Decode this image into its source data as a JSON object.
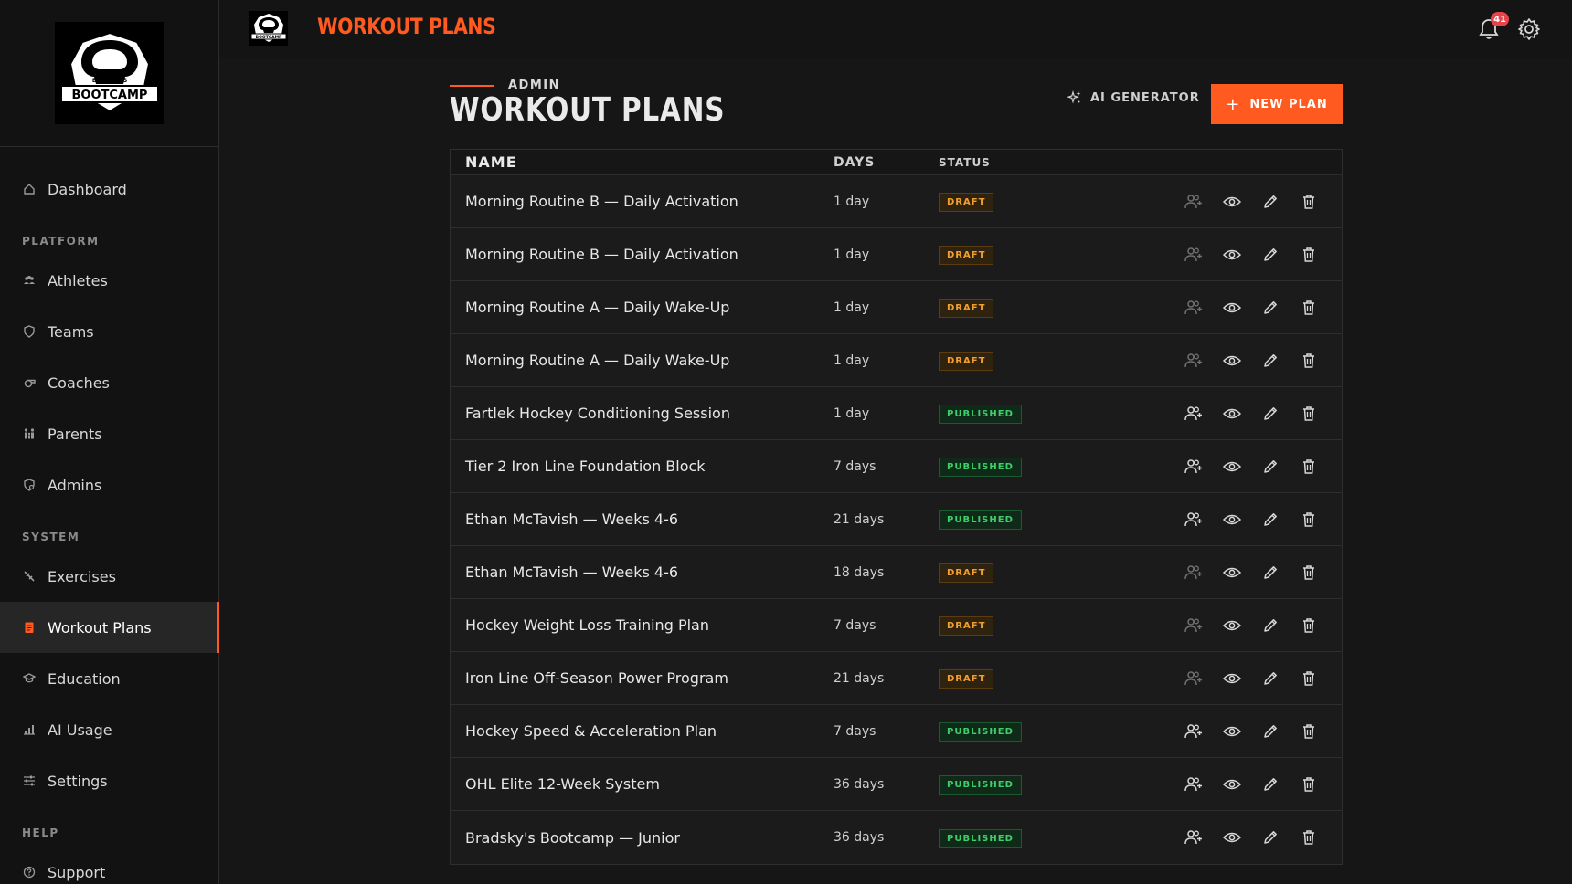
{
  "brand": {
    "logo_top": "BRADSKY'S",
    "logo_main": "BOOTCAMP",
    "mini_logo": "BOOTCAMP",
    "accent": "#ff5a1f"
  },
  "topbar": {
    "title": "WORKOUT PLANS",
    "notification_count": "41"
  },
  "sidebar": {
    "dashboard": "Dashboard",
    "sections": {
      "platform": "PLATFORM",
      "system": "SYSTEM",
      "help": "HELP"
    },
    "platform_items": [
      {
        "label": "Athletes",
        "icon": "athletes-icon"
      },
      {
        "label": "Teams",
        "icon": "shield-icon"
      },
      {
        "label": "Coaches",
        "icon": "whistle-icon"
      },
      {
        "label": "Parents",
        "icon": "family-icon"
      },
      {
        "label": "Admins",
        "icon": "admin-icon"
      }
    ],
    "system_items": [
      {
        "label": "Exercises",
        "icon": "dumbbell-icon"
      },
      {
        "label": "Workout Plans",
        "icon": "clipboard-icon",
        "active": true
      },
      {
        "label": "Education",
        "icon": "graduation-icon"
      },
      {
        "label": "AI Usage",
        "icon": "chart-icon"
      },
      {
        "label": "Settings",
        "icon": "sliders-icon"
      }
    ],
    "help_items": [
      {
        "label": "Support",
        "icon": "help-circle-icon"
      }
    ]
  },
  "header": {
    "eyebrow": "ADMIN",
    "title": "WORKOUT PLANS",
    "ai_generator": "AI GENERATOR",
    "new_plan": "NEW PLAN"
  },
  "table": {
    "columns": {
      "name": "NAME",
      "days": "DAYS",
      "status": "STATUS"
    },
    "rows": [
      {
        "name": "Morning Routine B — Daily Activation",
        "days": "1 day",
        "status": "DRAFT"
      },
      {
        "name": "Morning Routine B — Daily Activation",
        "days": "1 day",
        "status": "DRAFT"
      },
      {
        "name": "Morning Routine A — Daily Wake-Up",
        "days": "1 day",
        "status": "DRAFT"
      },
      {
        "name": "Morning Routine A — Daily Wake-Up",
        "days": "1 day",
        "status": "DRAFT"
      },
      {
        "name": "Fartlek Hockey Conditioning Session",
        "days": "1 day",
        "status": "PUBLISHED"
      },
      {
        "name": "Tier 2 Iron Line Foundation Block",
        "days": "7 days",
        "status": "PUBLISHED"
      },
      {
        "name": "Ethan McTavish — Weeks 4-6",
        "days": "21 days",
        "status": "PUBLISHED"
      },
      {
        "name": "Ethan McTavish — Weeks 4-6",
        "days": "18 days",
        "status": "DRAFT"
      },
      {
        "name": "Hockey Weight Loss Training Plan",
        "days": "7 days",
        "status": "DRAFT"
      },
      {
        "name": "Iron Line Off-Season Power Program",
        "days": "21 days",
        "status": "DRAFT"
      },
      {
        "name": "Hockey Speed & Acceleration Plan",
        "days": "7 days",
        "status": "PUBLISHED"
      },
      {
        "name": "OHL Elite 12-Week System",
        "days": "36 days",
        "status": "PUBLISHED"
      },
      {
        "name": "Bradsky's Bootcamp — Junior",
        "days": "36 days",
        "status": "PUBLISHED"
      }
    ]
  }
}
